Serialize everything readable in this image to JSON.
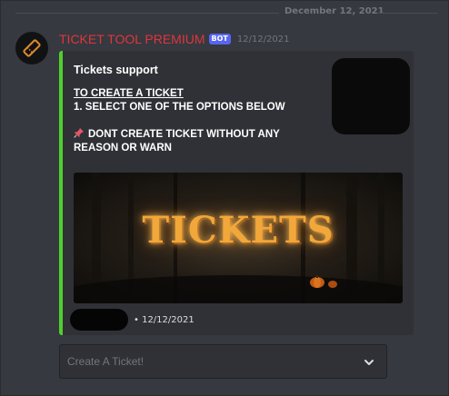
{
  "date_divider": "December 12, 2021",
  "message": {
    "username": "TICKET TOOL PREMIUM",
    "bot_tag": "BOT",
    "timestamp": "12/12/2021",
    "username_color": "#e0353d",
    "avatar_icon": "ticket-icon"
  },
  "embed": {
    "accent_color": "#4fcf2f",
    "title": "Tickets support",
    "create_heading": "TO CREATE A TICKET",
    "step": "1. SELECT ONE OF THE OPTIONS BELOW",
    "warning": "DONT CREATE TICKET WITHOUT ANY REASON OR WARN",
    "warning_icon": "pushpin-icon",
    "banner_text": "TICKETS",
    "footer_text": "• 12/12/2021"
  },
  "select_menu": {
    "placeholder": "Create A Ticket!",
    "icon": "chevron-down-icon"
  }
}
